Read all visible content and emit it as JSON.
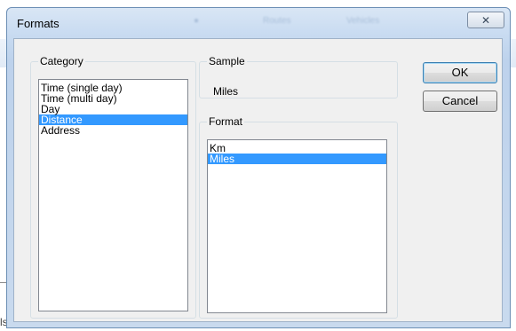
{
  "dialog": {
    "title": "Formats",
    "close_glyph": "✕",
    "blurred_title_fragments": [
      "●",
      "Routes",
      "Vehicles"
    ]
  },
  "category": {
    "label": "Category",
    "items": [
      "Time (single day)",
      "Time (multi day)",
      "Day",
      "Distance",
      "Address"
    ],
    "selected": "Distance"
  },
  "sample": {
    "label": "Sample",
    "value": "Miles"
  },
  "format": {
    "label": "Format",
    "items": [
      "Km",
      "Miles"
    ],
    "selected": "Miles"
  },
  "buttons": {
    "ok": "OK",
    "cancel": "Cancel"
  },
  "background": {
    "partial_text": "ls"
  },
  "colors": {
    "selection": "#3399ff",
    "client_bg": "#f0f0f0"
  }
}
